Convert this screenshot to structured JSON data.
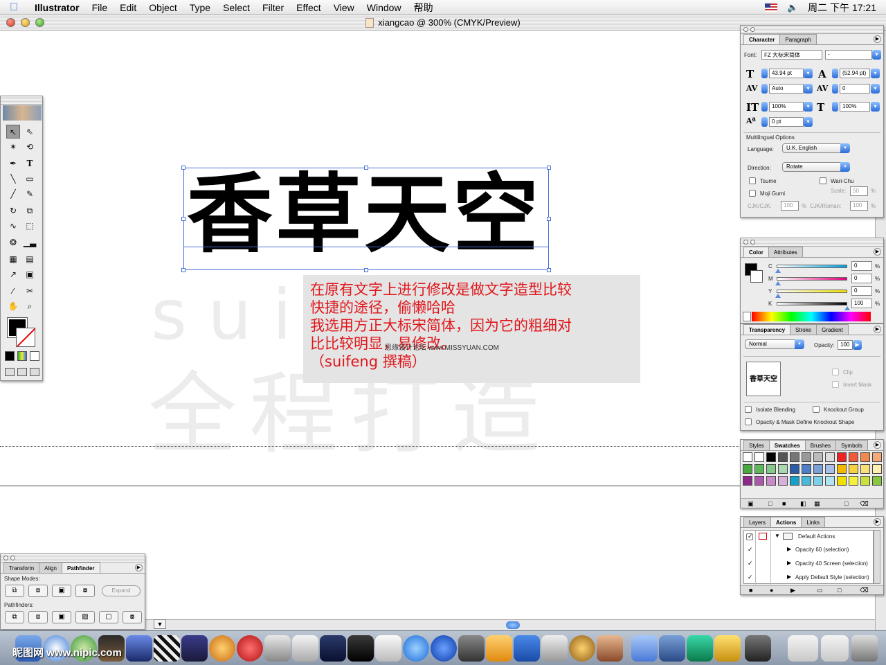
{
  "menubar": {
    "apple_glyph": "",
    "items": [
      "Illustrator",
      "File",
      "Edit",
      "Object",
      "Type",
      "Select",
      "Filter",
      "Effect",
      "View",
      "Window",
      "帮助"
    ],
    "clock": "周二 下午 17:21",
    "volume_glyph": "🔈"
  },
  "document": {
    "title": "xiangcao @ 300% (CMYK/Preview)",
    "headline": "香草天空",
    "watermark_latin": "suifeng",
    "watermark_cjk": "全程打造",
    "annotation_lines": [
      "在原有文字上进行修改是做文字造型比较",
      "快捷的途径，偷懒哈哈",
      "我选用方正大标宋简体，因为它的粗细对",
      "比比较明显，易修改。",
      "（suifeng 撰稿）"
    ],
    "annotation_site": "思缘设计论坛 www.MISSYUAN.COM",
    "zoom_arrow": "▼"
  },
  "character_panel": {
    "tabs": [
      "Character",
      "Paragraph"
    ],
    "font_label": "Font:",
    "font_value": "FZ 大标宋简体",
    "style_value": "-",
    "size": "43.94 pt",
    "leading": "(52.94 pt)",
    "kerning": "Auto",
    "tracking": "0",
    "vscale": "100%",
    "hscale": "100%",
    "baseline_shift": "0 pt",
    "multilingual_title": "Multilingual Options",
    "language_label": "Language:",
    "language_value": "U.K. English",
    "direction_label": "Direction:",
    "direction_value": "Rotate",
    "tsume": "Tsume",
    "wari_chu": "Wari-Chu",
    "moji_gumi": "Moji Gumi",
    "scale_label": "Scale:",
    "scale_value": "50",
    "scale_unit": "%",
    "cjk_cjk_label": "CJK/CJK:",
    "cjk_cjk_value": "100",
    "cjk_roman_label": "CJK/Roman:",
    "cjk_roman_value": "100",
    "percent": "%"
  },
  "color_panel": {
    "tabs": [
      "Color",
      "Attributes"
    ],
    "channels": [
      {
        "label": "C",
        "value": "0"
      },
      {
        "label": "M",
        "value": "0"
      },
      {
        "label": "Y",
        "value": "0"
      },
      {
        "label": "K",
        "value": "100"
      }
    ],
    "unit": "%"
  },
  "transparency_panel": {
    "tabs": [
      "Transparency",
      "Stroke",
      "Gradient"
    ],
    "blend_mode": "Normal",
    "opacity_label": "Opacity:",
    "opacity_value": "100",
    "thumbnail_text": "香草天空",
    "clip": "Clip",
    "invert_mask": "Invert Mask",
    "isolate_blending": "Isolate Blending",
    "knockout_group": "Knockout Group",
    "opacity_mask": "Opacity & Mask Define Knockout Shape"
  },
  "swatches_panel": {
    "tabs": [
      "Styles",
      "Swatches",
      "Brushes",
      "Symbols"
    ],
    "colors": [
      "#ffffff",
      "#ffffff",
      "#000000",
      "#555555",
      "#777777",
      "#999999",
      "#bbbbbb",
      "#dddddd",
      "#e8262a",
      "#ee5a3a",
      "#f08850",
      "#f5a878",
      "#49a83e",
      "#5cb85a",
      "#85c98a",
      "#a8d8b0",
      "#2a5da8",
      "#4c7fc8",
      "#7aa0d8",
      "#a8c0e8",
      "#f5b800",
      "#f8d040",
      "#fae078",
      "#fdf0b0",
      "#8a2a8a",
      "#a85aa8",
      "#c88ac8",
      "#d8b0d8",
      "#1aa0c8",
      "#4ab8d8",
      "#7cd0e8",
      "#b0e4f0",
      "#f0e000",
      "#f4f040",
      "#c8e040",
      "#88c840"
    ]
  },
  "layers_panel": {
    "tabs": [
      "Layers",
      "Actions",
      "Links"
    ],
    "set_name": "Default Actions",
    "actions": [
      "Opacity 60 (selection)",
      "Opacity 40 Screen (selection)",
      "Apply Default Style (selection)"
    ]
  },
  "pathfinder_panel": {
    "tabs": [
      "Transform",
      "Align",
      "Pathfinder"
    ],
    "shape_modes_label": "Shape Modes:",
    "expand_label": "Expand",
    "pathfinders_label": "Pathfinders:"
  },
  "dock": {
    "watermark": "昵图网 www.nipic.com"
  }
}
